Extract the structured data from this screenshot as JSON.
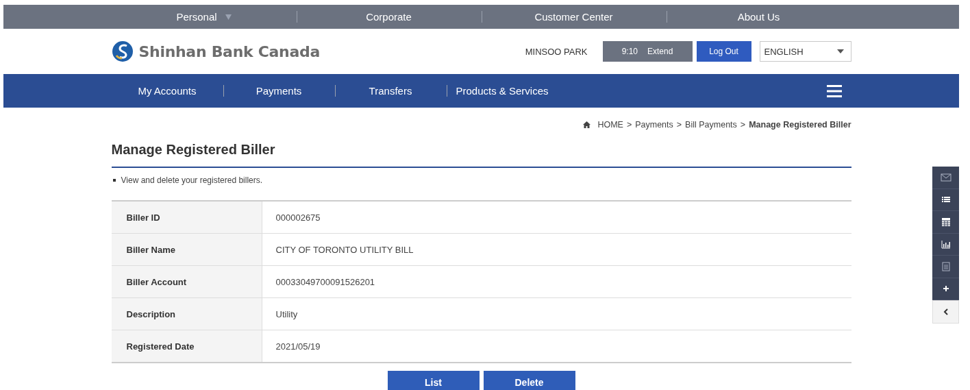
{
  "top_menu": [
    {
      "label": "Personal",
      "has_dropdown": true
    },
    {
      "label": "Corporate",
      "has_dropdown": false
    },
    {
      "label": "Customer Center",
      "has_dropdown": false
    },
    {
      "label": "About Us",
      "has_dropdown": false
    }
  ],
  "header": {
    "logo": "Shinhan Bank Canada",
    "user": "MINSOO PARK",
    "timer": "9:10",
    "extend": "Extend",
    "logout": "Log Out",
    "language": "ENGLISH"
  },
  "main_nav": [
    {
      "label": "My Accounts"
    },
    {
      "label": "Payments"
    },
    {
      "label": "Transfers"
    },
    {
      "label": "Products & Services"
    }
  ],
  "breadcrumb": [
    "HOME",
    "Payments",
    "Bill Payments",
    "Manage Registered Biller"
  ],
  "breadcrumb_separator": ">",
  "title": "Manage Registered Biller",
  "note": "View and delete your registered billers.",
  "details": [
    {
      "label": "Biller ID",
      "value": "000002675"
    },
    {
      "label": "Biller Name",
      "value": "CITY OF TORONTO UTILITY BILL"
    },
    {
      "label": "Biller Account",
      "value": "00033049700091526201"
    },
    {
      "label": "Description",
      "value": "Utility"
    },
    {
      "label": "Registered Date",
      "value": "2021/05/19"
    }
  ],
  "buttons": [
    "List",
    "Delete"
  ],
  "quick_menu": [
    {
      "kind": "mail"
    },
    {
      "kind": "list"
    },
    {
      "kind": "calculator"
    },
    {
      "kind": "chart"
    },
    {
      "kind": "document"
    },
    {
      "kind": "plus"
    },
    {
      "kind": "collapse"
    }
  ]
}
